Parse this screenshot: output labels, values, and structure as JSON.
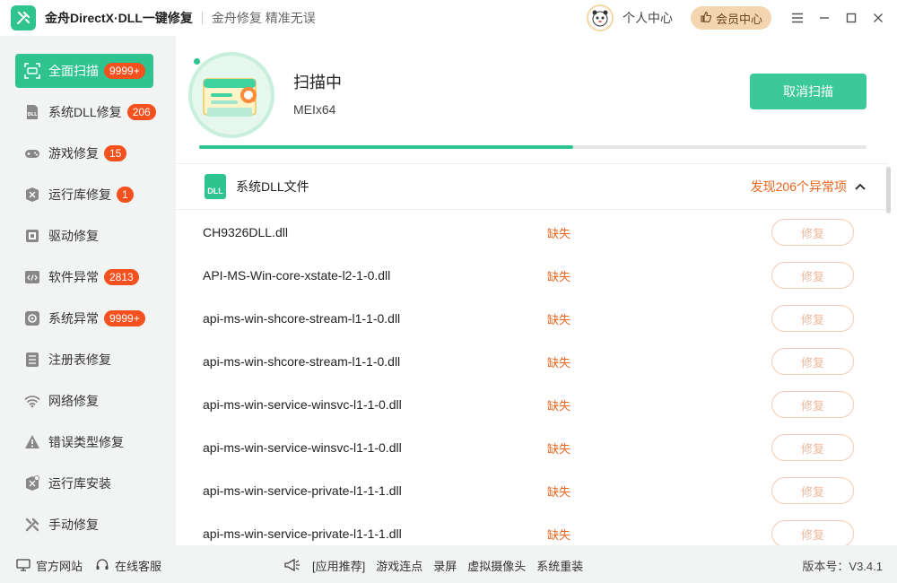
{
  "titlebar": {
    "app_title": "金舟DirectX·DLL一键修复",
    "slogan": "金舟修复 精准无误",
    "personal_center": "个人中心",
    "vip_center": "会员中心"
  },
  "sidebar": {
    "items": [
      {
        "label": "全面扫描",
        "badge": "9999+",
        "icon": "full-scan-icon",
        "active": true
      },
      {
        "label": "系统DLL修复",
        "badge": "206",
        "icon": "dll-icon"
      },
      {
        "label": "游戏修复",
        "badge": "15",
        "icon": "gamepad-icon"
      },
      {
        "label": "运行库修复",
        "badge": "1",
        "icon": "runtime-icon"
      },
      {
        "label": "驱动修复",
        "badge": "",
        "icon": "driver-icon"
      },
      {
        "label": "软件异常",
        "badge": "2813",
        "icon": "code-icon"
      },
      {
        "label": "系统异常",
        "badge": "9999+",
        "icon": "gear-icon"
      },
      {
        "label": "注册表修复",
        "badge": "",
        "icon": "list-icon"
      },
      {
        "label": "网络修复",
        "badge": "",
        "icon": "wifi-icon"
      },
      {
        "label": "错误类型修复",
        "badge": "",
        "icon": "warning-icon"
      },
      {
        "label": "运行库安装",
        "badge": "",
        "icon": "install-icon"
      },
      {
        "label": "手动修复",
        "badge": "",
        "icon": "wrench-icon"
      }
    ]
  },
  "scan": {
    "status": "扫描中",
    "target": "MEIx64",
    "cancel_label": "取消扫描",
    "progress": 0.56
  },
  "section": {
    "icon_text": "DLL",
    "title": "系统DLL文件",
    "count": "发现206个异常项"
  },
  "files": [
    {
      "name": "CH9326DLL.dll",
      "status": "缺失",
      "action": "修复"
    },
    {
      "name": "API-MS-Win-core-xstate-l2-1-0.dll",
      "status": "缺失",
      "action": "修复"
    },
    {
      "name": "api-ms-win-shcore-stream-l1-1-0.dll",
      "status": "缺失",
      "action": "修复"
    },
    {
      "name": "api-ms-win-shcore-stream-l1-1-0.dll",
      "status": "缺失",
      "action": "修复"
    },
    {
      "name": "api-ms-win-service-winsvc-l1-1-0.dll",
      "status": "缺失",
      "action": "修复"
    },
    {
      "name": "api-ms-win-service-winsvc-l1-1-0.dll",
      "status": "缺失",
      "action": "修复"
    },
    {
      "name": "api-ms-win-service-private-l1-1-1.dll",
      "status": "缺失",
      "action": "修复"
    },
    {
      "name": "api-ms-win-service-private-l1-1-1.dll",
      "status": "缺失",
      "action": "修复"
    }
  ],
  "footer": {
    "official_site": "官方网站",
    "online_service": "在线客服",
    "promo": [
      "[应用推荐]",
      "游戏连点",
      "录屏",
      "虚拟摄像头",
      "系统重装"
    ],
    "version": "版本号：V3.4.1"
  },
  "colors": {
    "accent": "#2fc38f",
    "warning": "#e8661f",
    "badge": "#f4511e"
  }
}
